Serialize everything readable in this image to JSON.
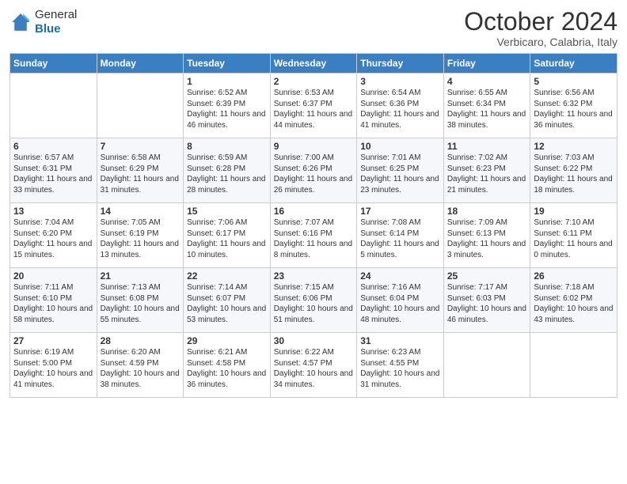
{
  "header": {
    "logo_line1": "General",
    "logo_line2": "Blue",
    "month": "October 2024",
    "location": "Verbicaro, Calabria, Italy"
  },
  "weekdays": [
    "Sunday",
    "Monday",
    "Tuesday",
    "Wednesday",
    "Thursday",
    "Friday",
    "Saturday"
  ],
  "weeks": [
    [
      {
        "day": "",
        "info": ""
      },
      {
        "day": "",
        "info": ""
      },
      {
        "day": "1",
        "info": "Sunrise: 6:52 AM\nSunset: 6:39 PM\nDaylight: 11 hours and 46 minutes."
      },
      {
        "day": "2",
        "info": "Sunrise: 6:53 AM\nSunset: 6:37 PM\nDaylight: 11 hours and 44 minutes."
      },
      {
        "day": "3",
        "info": "Sunrise: 6:54 AM\nSunset: 6:36 PM\nDaylight: 11 hours and 41 minutes."
      },
      {
        "day": "4",
        "info": "Sunrise: 6:55 AM\nSunset: 6:34 PM\nDaylight: 11 hours and 38 minutes."
      },
      {
        "day": "5",
        "info": "Sunrise: 6:56 AM\nSunset: 6:32 PM\nDaylight: 11 hours and 36 minutes."
      }
    ],
    [
      {
        "day": "6",
        "info": "Sunrise: 6:57 AM\nSunset: 6:31 PM\nDaylight: 11 hours and 33 minutes."
      },
      {
        "day": "7",
        "info": "Sunrise: 6:58 AM\nSunset: 6:29 PM\nDaylight: 11 hours and 31 minutes."
      },
      {
        "day": "8",
        "info": "Sunrise: 6:59 AM\nSunset: 6:28 PM\nDaylight: 11 hours and 28 minutes."
      },
      {
        "day": "9",
        "info": "Sunrise: 7:00 AM\nSunset: 6:26 PM\nDaylight: 11 hours and 26 minutes."
      },
      {
        "day": "10",
        "info": "Sunrise: 7:01 AM\nSunset: 6:25 PM\nDaylight: 11 hours and 23 minutes."
      },
      {
        "day": "11",
        "info": "Sunrise: 7:02 AM\nSunset: 6:23 PM\nDaylight: 11 hours and 21 minutes."
      },
      {
        "day": "12",
        "info": "Sunrise: 7:03 AM\nSunset: 6:22 PM\nDaylight: 11 hours and 18 minutes."
      }
    ],
    [
      {
        "day": "13",
        "info": "Sunrise: 7:04 AM\nSunset: 6:20 PM\nDaylight: 11 hours and 15 minutes."
      },
      {
        "day": "14",
        "info": "Sunrise: 7:05 AM\nSunset: 6:19 PM\nDaylight: 11 hours and 13 minutes."
      },
      {
        "day": "15",
        "info": "Sunrise: 7:06 AM\nSunset: 6:17 PM\nDaylight: 11 hours and 10 minutes."
      },
      {
        "day": "16",
        "info": "Sunrise: 7:07 AM\nSunset: 6:16 PM\nDaylight: 11 hours and 8 minutes."
      },
      {
        "day": "17",
        "info": "Sunrise: 7:08 AM\nSunset: 6:14 PM\nDaylight: 11 hours and 5 minutes."
      },
      {
        "day": "18",
        "info": "Sunrise: 7:09 AM\nSunset: 6:13 PM\nDaylight: 11 hours and 3 minutes."
      },
      {
        "day": "19",
        "info": "Sunrise: 7:10 AM\nSunset: 6:11 PM\nDaylight: 11 hours and 0 minutes."
      }
    ],
    [
      {
        "day": "20",
        "info": "Sunrise: 7:11 AM\nSunset: 6:10 PM\nDaylight: 10 hours and 58 minutes."
      },
      {
        "day": "21",
        "info": "Sunrise: 7:13 AM\nSunset: 6:08 PM\nDaylight: 10 hours and 55 minutes."
      },
      {
        "day": "22",
        "info": "Sunrise: 7:14 AM\nSunset: 6:07 PM\nDaylight: 10 hours and 53 minutes."
      },
      {
        "day": "23",
        "info": "Sunrise: 7:15 AM\nSunset: 6:06 PM\nDaylight: 10 hours and 51 minutes."
      },
      {
        "day": "24",
        "info": "Sunrise: 7:16 AM\nSunset: 6:04 PM\nDaylight: 10 hours and 48 minutes."
      },
      {
        "day": "25",
        "info": "Sunrise: 7:17 AM\nSunset: 6:03 PM\nDaylight: 10 hours and 46 minutes."
      },
      {
        "day": "26",
        "info": "Sunrise: 7:18 AM\nSunset: 6:02 PM\nDaylight: 10 hours and 43 minutes."
      }
    ],
    [
      {
        "day": "27",
        "info": "Sunrise: 6:19 AM\nSunset: 5:00 PM\nDaylight: 10 hours and 41 minutes."
      },
      {
        "day": "28",
        "info": "Sunrise: 6:20 AM\nSunset: 4:59 PM\nDaylight: 10 hours and 38 minutes."
      },
      {
        "day": "29",
        "info": "Sunrise: 6:21 AM\nSunset: 4:58 PM\nDaylight: 10 hours and 36 minutes."
      },
      {
        "day": "30",
        "info": "Sunrise: 6:22 AM\nSunset: 4:57 PM\nDaylight: 10 hours and 34 minutes."
      },
      {
        "day": "31",
        "info": "Sunrise: 6:23 AM\nSunset: 4:55 PM\nDaylight: 10 hours and 31 minutes."
      },
      {
        "day": "",
        "info": ""
      },
      {
        "day": "",
        "info": ""
      }
    ]
  ]
}
